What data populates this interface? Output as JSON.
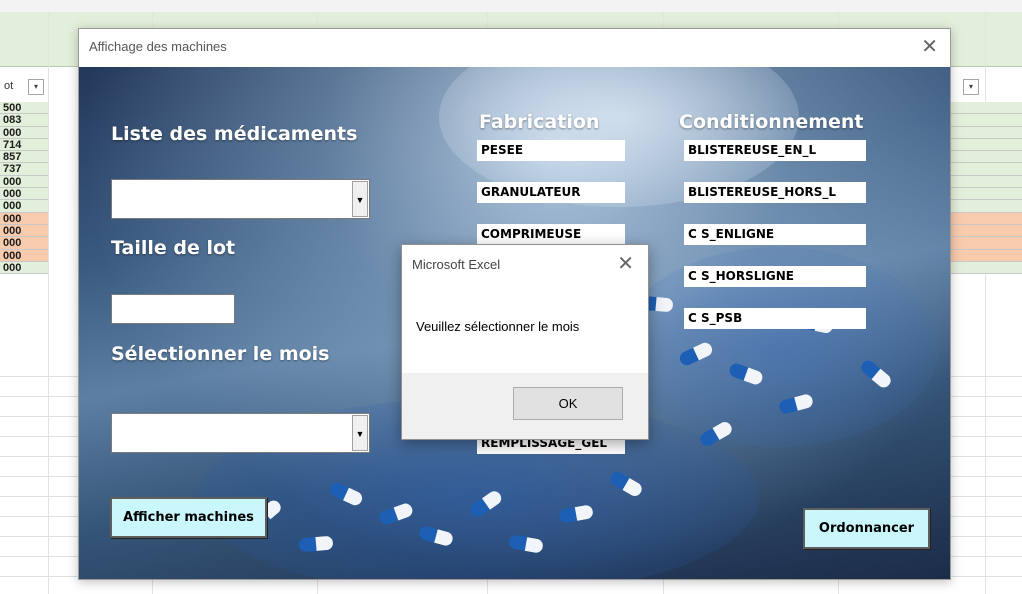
{
  "sheet": {
    "column_header_fragment": "ot",
    "values": [
      "500",
      "083",
      "000",
      "714",
      "857",
      "737",
      "000",
      "000",
      "000",
      "000",
      "000",
      "000",
      "000",
      "000"
    ],
    "orange_rows": [
      9,
      10,
      11,
      12
    ]
  },
  "form": {
    "title": "Affichage des machines",
    "close_glyph": "✕",
    "labels": {
      "medicaments": "Liste des médicaments",
      "taille_lot": "Taille de lot",
      "mois": "Sélectionner le mois",
      "fabrication": "Fabrication",
      "conditionnement": "Conditionnement"
    },
    "medicament_combo": {
      "value": ""
    },
    "taille_lot_input": {
      "value": ""
    },
    "mois_combo": {
      "value": ""
    },
    "fabrication_items": [
      "PESEE",
      "GRANULATEUR",
      "COMPRIMEUSE",
      "",
      "",
      "",
      "REMPLISSAGE_GEL"
    ],
    "conditionnement_items": [
      "BLISTEREUSE_EN_L",
      "BLISTEREUSE_HORS_L",
      "C S_ENLIGNE",
      "C S_HORSLIGNE",
      "C S_PSB"
    ],
    "buttons": {
      "afficher": "Afficher machines",
      "ordonnancer": "Ordonnancer"
    }
  },
  "msgbox": {
    "title": "Microsoft Excel",
    "close_glyph": "✕",
    "message": "Veuillez sélectionner le mois",
    "ok": "OK"
  },
  "colors": {
    "button_bg": "#c9f7fb",
    "sheet_green": "#e2efda",
    "sheet_orange": "#f8cbad",
    "capsule_blue": "#1d5fb4"
  },
  "icons": {
    "dropdown": "▼",
    "filter": "▾"
  }
}
